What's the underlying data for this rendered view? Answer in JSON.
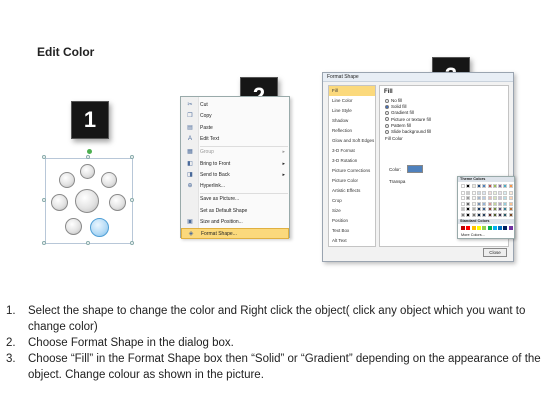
{
  "title": "Edit Color",
  "steps": [
    "1",
    "2",
    "3"
  ],
  "context_menu": {
    "items": [
      {
        "label": "Cut",
        "icon": "cut-icon",
        "glyph": "✂"
      },
      {
        "label": "Copy",
        "icon": "copy-icon",
        "glyph": "❐"
      },
      {
        "label": "Paste",
        "icon": "paste-icon",
        "glyph": "▤"
      },
      {
        "label": "Edit Text",
        "icon": "edit-text-icon",
        "glyph": "A"
      },
      {
        "label": "Group",
        "icon": "group-icon",
        "glyph": "▦",
        "disabled": true,
        "submenu": true
      },
      {
        "label": "Bring to Front",
        "icon": "bring-to-front-icon",
        "glyph": "◧",
        "submenu": true
      },
      {
        "label": "Send to Back",
        "icon": "send-to-back-icon",
        "glyph": "◨",
        "submenu": true
      },
      {
        "label": "Hyperlink...",
        "icon": "hyperlink-icon",
        "glyph": "⊕"
      },
      {
        "label": "Save as Picture...",
        "icon": "",
        "glyph": ""
      },
      {
        "label": "Set as Default Shape",
        "icon": "",
        "glyph": ""
      },
      {
        "label": "Size and Position...",
        "icon": "size-position-icon",
        "glyph": "▣"
      },
      {
        "label": "Format Shape...",
        "icon": "format-shape-icon",
        "glyph": "◈",
        "highlighted": true
      }
    ]
  },
  "dialog": {
    "title": "Format Shape",
    "nav": [
      "Fill",
      "Line Color",
      "Line Style",
      "Shadow",
      "Reflection",
      "Glow and Soft Edges",
      "3-D Format",
      "3-D Rotation",
      "Picture Corrections",
      "Picture Color",
      "Artistic Effects",
      "Crop",
      "Size",
      "Position",
      "Text Box",
      "Alt Text"
    ],
    "heading": "Fill",
    "options": [
      "No fill",
      "Solid fill",
      "Gradient fill",
      "Picture or texture fill",
      "Pattern fill",
      "Slide background fill"
    ],
    "selected_option": "Solid fill",
    "fill_color_label": "Fill Color",
    "color_label": "Color:",
    "transparency_label": "Transpa",
    "theme_colors_label": "Theme Colors",
    "standard_colors_label": "Standard Colors",
    "more_colors_label": "More Colors...",
    "close_label": "Close",
    "theme_colors": [
      "#ffffff",
      "#000000",
      "#eeece1",
      "#1f497d",
      "#4f81bd",
      "#c0504d",
      "#9bbb59",
      "#8064a2",
      "#4bacc6",
      "#f79646"
    ],
    "standard_colors": [
      "#c00000",
      "#ff0000",
      "#ffc000",
      "#ffff00",
      "#92d050",
      "#00b050",
      "#00b0f0",
      "#0070c0",
      "#002060",
      "#7030a0"
    ]
  },
  "instructions": [
    {
      "num": "1.",
      "text": "Select the shape to change the color and Right click the object( click any object which you want to change color)"
    },
    {
      "num": "2.",
      "text": "Choose Format Shape in the dialog box."
    },
    {
      "num": "3.",
      "text": "Choose “Fill” in the Format Shape box then “Solid” or “Gradient” depending on the appearance of the object. Change colour as shown in the picture."
    }
  ]
}
